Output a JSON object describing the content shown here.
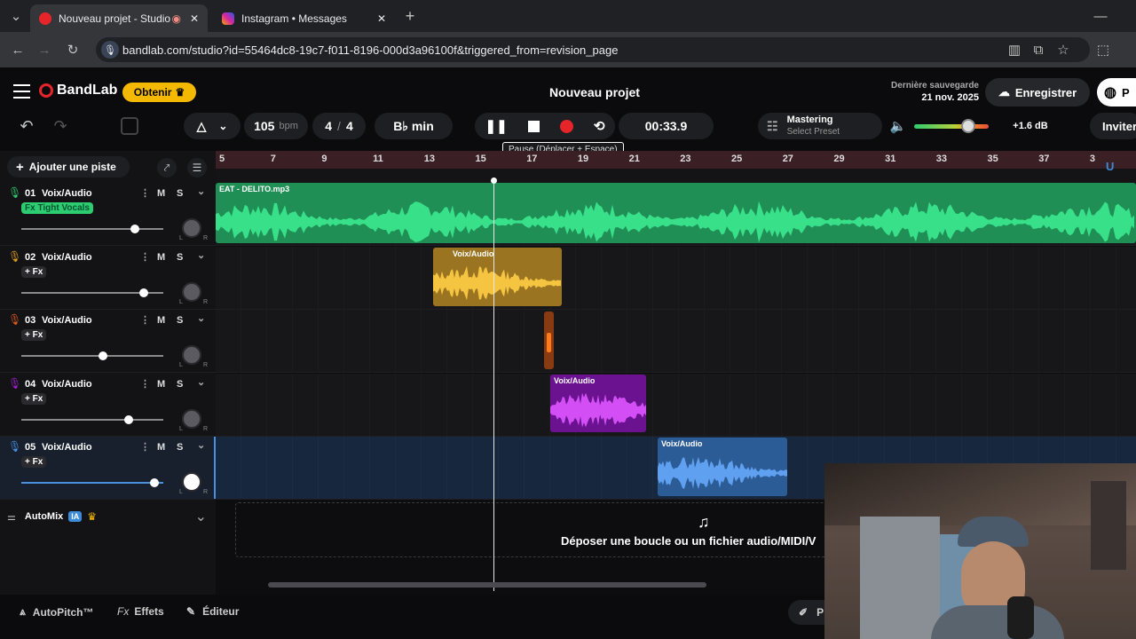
{
  "browser": {
    "tabs": [
      {
        "title": "Nouveau projet - Studio",
        "active": true
      },
      {
        "title": "Instagram • Messages",
        "active": false
      }
    ],
    "url": "bandlab.com/studio?id=55464dc8-19c7-f011-8196-000d3a96100f&triggered_from=revision_page"
  },
  "header": {
    "brand": "BandLab",
    "get_button": "Obtenir",
    "project_title": "Nouveau projet",
    "last_saved_label": "Dernière sauvegarde",
    "last_saved_date": "21 nov. 2025",
    "save_button": "Enregistrer",
    "profile_partial": "P"
  },
  "toolbar": {
    "bpm_value": "105",
    "bpm_unit": "bpm",
    "time_sig_num": "4",
    "time_sig_den": "4",
    "key": "B♭ min",
    "time": "00:33.9",
    "mastering_title": "Mastering",
    "mastering_preset": "Select Preset",
    "volume_db": "+1.6 dB",
    "invite": "Inviter",
    "tooltip": "Pause (Déplacer + Espace)"
  },
  "left": {
    "add_track": "Ajouter une piste",
    "automix": "AutoMix",
    "ia_badge": "IA"
  },
  "ruler": [
    "5",
    "7",
    "9",
    "11",
    "13",
    "15",
    "17",
    "19",
    "21",
    "23",
    "25",
    "27",
    "29",
    "31",
    "33",
    "35",
    "37",
    "3"
  ],
  "tracks": [
    {
      "num": "01",
      "name": "Voix/Audio",
      "fx": "Fx Tight Vocals",
      "color": "#2ecc71",
      "vol": 0.85
    },
    {
      "num": "02",
      "name": "Voix/Audio",
      "fx": "+ Fx",
      "color": "#e0a020",
      "vol": 0.92
    },
    {
      "num": "03",
      "name": "Voix/Audio",
      "fx": "+ Fx",
      "color": "#e05a20",
      "vol": 0.6
    },
    {
      "num": "04",
      "name": "Voix/Audio",
      "fx": "+ Fx",
      "color": "#a020d0",
      "vol": 0.8
    },
    {
      "num": "05",
      "name": "Voix/Audio",
      "fx": "+ Fx",
      "color": "#4a90e2",
      "vol": 1.0
    }
  ],
  "clips": {
    "c1": "EAT - DELITO.mp3",
    "c2": "Voix/Audio",
    "c4": "Voix/Audio",
    "c5": "Voix/Audio"
  },
  "drop_zone": "Déposer une boucle ou un fichier audio/MIDI/V",
  "bottom": {
    "autopitch": "AutoPitch™",
    "effects": "Effets",
    "editor": "Éditeur",
    "fx_prefix": "Fx",
    "right_partial": "P"
  }
}
